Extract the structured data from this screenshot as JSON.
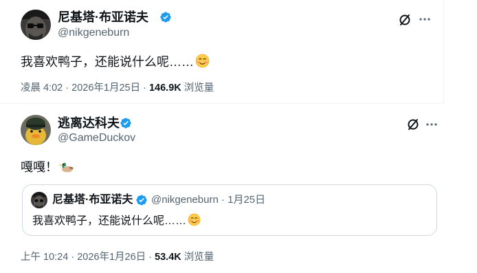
{
  "tweet1": {
    "author_name": "尼基塔·布亚诺夫",
    "author_handle": "@nikgeneburn",
    "text": "我喜欢鸭子，还能说什么呢……",
    "emoji": "smiling-blush-emoji",
    "time": "凌晨 4:02 · 2026年1月25日 · ",
    "views_count": "146.9K",
    "views_label": " 浏览量",
    "verified_color": "#1d9bf0"
  },
  "tweet2": {
    "author_name": "逃离达科夫",
    "author_handle": "@GameDuckov",
    "text": "嘎嘎！",
    "emoji": "duck-emoji",
    "time": "上午 10:24 · 2026年1月26日 · ",
    "views_count": "53.4K",
    "views_label": " 浏览量",
    "quote": {
      "author_name": "尼基塔·布亚诺夫",
      "author_handle": "@nikgeneburn",
      "date": " · 1月25日",
      "text": "我喜欢鸭子，还能说什么呢……",
      "emoji": "smiling-blush-emoji"
    }
  },
  "icons": {
    "grok": "grok-icon",
    "more": "more-dots-icon",
    "verified": "verified-badge-icon"
  }
}
